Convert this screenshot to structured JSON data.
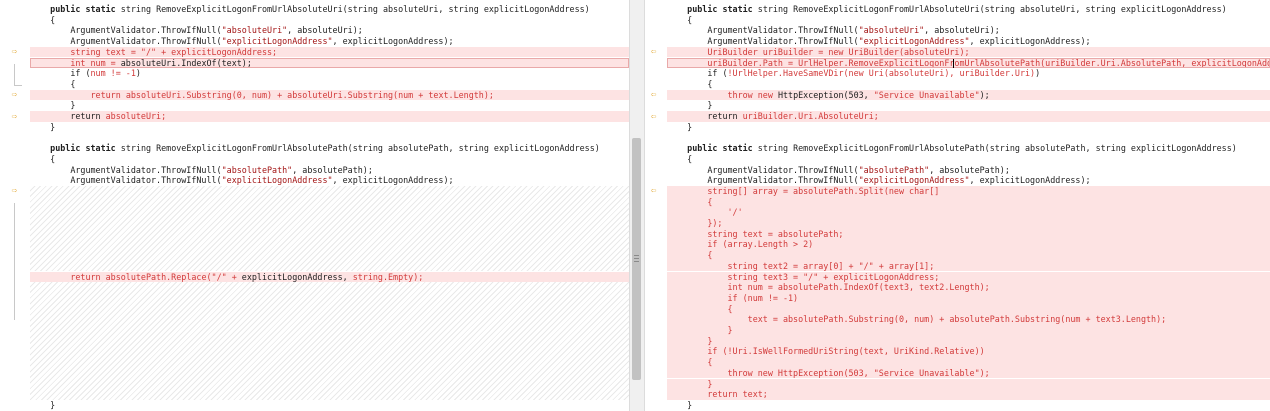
{
  "left_pane": {
    "lines": [
      {
        "segments": [
          {
            "text": "    "
          },
          {
            "text": "public static",
            "bold": true
          },
          {
            "text": " string RemoveExplicitLogonFromUrlAbsoluteUri(string absoluteUri, string explicitLogonAddress)"
          }
        ]
      },
      {
        "segments": [
          {
            "text": "    {"
          }
        ]
      },
      {
        "segments": [
          {
            "text": "        ArgumentValidator.ThrowIfNull("
          },
          {
            "text": "\"absoluteUri\"",
            "color": "#a31515"
          },
          {
            "text": ", absoluteUri);"
          }
        ]
      },
      {
        "segments": [
          {
            "text": "        ArgumentValidator.ThrowIfNull("
          },
          {
            "text": "\"explicitLogonAddress\"",
            "color": "#a31515"
          },
          {
            "text": ", explicitLogonAddress);"
          }
        ]
      },
      {
        "changed": true,
        "segments": [
          {
            "text": "        string text = \"/\" + explicitLogonAddress;",
            "color": "#d23a3a"
          }
        ]
      },
      {
        "changed": true,
        "selected": true,
        "segments": [
          {
            "text": "        int num = ",
            "color": "#d23a3a"
          },
          {
            "text": "absoluteUri.IndexOf(text);"
          }
        ]
      },
      {
        "segments": [
          {
            "text": "        if ("
          },
          {
            "text": "num != -1",
            "color": "#d23a3a"
          },
          {
            "text": ")"
          }
        ]
      },
      {
        "segments": [
          {
            "text": "        {"
          }
        ]
      },
      {
        "changed": true,
        "segments": [
          {
            "text": "            "
          },
          {
            "text": "return",
            "color": "#d23a3a"
          },
          {
            "text": " absoluteUri.Substring(0, num) + absoluteUri.Substring(num + text.Length);",
            "color": "#d23a3a"
          }
        ]
      },
      {
        "segments": [
          {
            "text": "        }"
          }
        ]
      },
      {
        "changed": true,
        "segments": [
          {
            "text": "        return "
          },
          {
            "text": "absoluteUri;",
            "color": "#d23a3a"
          }
        ]
      },
      {
        "segments": [
          {
            "text": "    }"
          }
        ]
      },
      {
        "segments": [
          {
            "text": ""
          }
        ]
      },
      {
        "segments": [
          {
            "text": "    "
          },
          {
            "text": "public static",
            "bold": true
          },
          {
            "text": " string RemoveExplicitLogonFromUrlAbsolutePath(string absolutePath, string explicitLogonAddress)"
          }
        ]
      },
      {
        "segments": [
          {
            "text": "    {"
          }
        ]
      },
      {
        "segments": [
          {
            "text": "        ArgumentValidator.ThrowIfNull("
          },
          {
            "text": "\"absolutePath\"",
            "color": "#a31515"
          },
          {
            "text": ", absolutePath);"
          }
        ]
      },
      {
        "segments": [
          {
            "text": "        ArgumentValidator.ThrowIfNull("
          },
          {
            "text": "\"explicitLogonAddress\"",
            "color": "#a31515"
          },
          {
            "text": ", explicitLogonAddress);"
          }
        ]
      },
      {
        "hatch_rows": 8
      },
      {
        "changed": true,
        "segments": [
          {
            "text": "        "
          },
          {
            "text": "return absolutePath.Replace(\"/\" + ",
            "color": "#d23a3a"
          },
          {
            "text": "explicitLogonAddress, "
          },
          {
            "text": "string.Empty);",
            "color": "#d23a3a"
          }
        ]
      },
      {
        "hatch_rows": 11
      },
      {
        "segments": [
          {
            "text": "    }"
          }
        ]
      }
    ]
  },
  "right_pane": {
    "lines": [
      {
        "segments": [
          {
            "text": "    "
          },
          {
            "text": "public static",
            "bold": true
          },
          {
            "text": " string RemoveExplicitLogonFromUrlAbsoluteUri(string absoluteUri, string explicitLogonAddress)"
          }
        ]
      },
      {
        "segments": [
          {
            "text": "    {"
          }
        ]
      },
      {
        "segments": [
          {
            "text": "        ArgumentValidator.ThrowIfNull("
          },
          {
            "text": "\"absoluteUri\"",
            "color": "#a31515"
          },
          {
            "text": ", absoluteUri);"
          }
        ]
      },
      {
        "segments": [
          {
            "text": "        ArgumentValidator.ThrowIfNull("
          },
          {
            "text": "\"explicitLogonAddress\"",
            "color": "#a31515"
          },
          {
            "text": ", explicitLogonAddress);"
          }
        ]
      },
      {
        "changed": true,
        "segments": [
          {
            "text": "        UriBuilder uriBuilder = new UriBuilder(absoluteUri);",
            "color": "#d23a3a"
          }
        ]
      },
      {
        "changed": true,
        "selected": true,
        "segments": [
          {
            "text": "        uriBuilder.Path = UrlHelper.RemoveExplicitLogonFromUrlAbsolutePath(uriBuilder.Uri.AbsolutePath, explicitLogonAddress);",
            "color": "#d23a3a"
          }
        ]
      },
      {
        "segments": [
          {
            "text": "        if ("
          },
          {
            "text": "!UrlHelper.HaveSameVDir(new Uri(absoluteUri), uriBuilder.Uri)",
            "color": "#d23a3a"
          },
          {
            "text": ")"
          }
        ]
      },
      {
        "segments": [
          {
            "text": "        {"
          }
        ]
      },
      {
        "changed": true,
        "segments": [
          {
            "text": "            "
          },
          {
            "text": "throw new",
            "color": "#d23a3a"
          },
          {
            "text": " HttpException(503, "
          },
          {
            "text": "\"Service Unavailable\"",
            "color": "#d23a3a"
          },
          {
            "text": ");"
          }
        ]
      },
      {
        "segments": [
          {
            "text": "        }"
          }
        ]
      },
      {
        "changed": true,
        "segments": [
          {
            "text": "        return "
          },
          {
            "text": "uriBuilder.Uri.AbsoluteUri;",
            "color": "#d23a3a"
          }
        ]
      },
      {
        "segments": [
          {
            "text": "    }"
          }
        ]
      },
      {
        "segments": [
          {
            "text": ""
          }
        ]
      },
      {
        "segments": [
          {
            "text": "    "
          },
          {
            "text": "public static",
            "bold": true
          },
          {
            "text": " string RemoveExplicitLogonFromUrlAbsolutePath(string absolutePath, string explicitLogonAddress)"
          }
        ]
      },
      {
        "segments": [
          {
            "text": "    {"
          }
        ]
      },
      {
        "segments": [
          {
            "text": "        ArgumentValidator.ThrowIfNull("
          },
          {
            "text": "\"absolutePath\"",
            "color": "#a31515"
          },
          {
            "text": ", absolutePath);"
          }
        ]
      },
      {
        "segments": [
          {
            "text": "        ArgumentValidator.ThrowIfNull("
          },
          {
            "text": "\"explicitLogonAddress\"",
            "color": "#a31515"
          },
          {
            "text": ", explicitLogonAddress);"
          }
        ]
      },
      {
        "changed": true,
        "segments": [
          {
            "text": "        string[] array = absolutePath.Split(new char[]",
            "color": "#d23a3a"
          }
        ]
      },
      {
        "changed": true,
        "segments": [
          {
            "text": "        {",
            "color": "#d23a3a"
          }
        ]
      },
      {
        "changed": true,
        "segments": [
          {
            "text": "            '/'",
            "color": "#d23a3a"
          }
        ]
      },
      {
        "changed": true,
        "segments": [
          {
            "text": "        });",
            "color": "#d23a3a"
          }
        ]
      },
      {
        "changed": true,
        "segments": [
          {
            "text": "        string text = absolutePath;",
            "color": "#d23a3a"
          }
        ]
      },
      {
        "changed": true,
        "segments": [
          {
            "text": "        if (array.Length > 2)",
            "color": "#d23a3a"
          }
        ]
      },
      {
        "changed": true,
        "segments": [
          {
            "text": "        {",
            "color": "#d23a3a"
          }
        ]
      },
      {
        "changed": true,
        "segments": [
          {
            "text": "            string text2 = array[0] + \"/\" + array[1];",
            "color": "#d23a3a"
          }
        ]
      },
      {
        "changed": true,
        "segments": [
          {
            "text": "            string text3 = \"/\" + explicitLogonAddress;",
            "color": "#d23a3a"
          }
        ]
      },
      {
        "changed": true,
        "segments": [
          {
            "text": "            int num = absolutePath.IndexOf(text3, text2.Length);",
            "color": "#d23a3a"
          }
        ]
      },
      {
        "changed": true,
        "segments": [
          {
            "text": "            if (num != -1)",
            "color": "#d23a3a"
          }
        ]
      },
      {
        "changed": true,
        "segments": [
          {
            "text": "            {",
            "color": "#d23a3a"
          }
        ]
      },
      {
        "changed": true,
        "segments": [
          {
            "text": "                text = absolutePath.Substring(0, num) + absolutePath.Substring(num + text3.Length);",
            "color": "#d23a3a"
          }
        ]
      },
      {
        "changed": true,
        "segments": [
          {
            "text": "            }",
            "color": "#d23a3a"
          }
        ]
      },
      {
        "changed": true,
        "segments": [
          {
            "text": "        }",
            "color": "#d23a3a"
          }
        ]
      },
      {
        "changed": true,
        "segments": [
          {
            "text": "        if (!Uri.IsWellFormedUriString(text, UriKind.Relative))",
            "color": "#d23a3a"
          }
        ]
      },
      {
        "changed": true,
        "segments": [
          {
            "text": "        {",
            "color": "#d23a3a"
          }
        ]
      },
      {
        "changed": true,
        "segments": [
          {
            "text": "            throw new HttpException(503, \"Service Unavailable\");",
            "color": "#d23a3a"
          }
        ]
      },
      {
        "changed": true,
        "segments": [
          {
            "text": "        }",
            "color": "#d23a3a"
          }
        ]
      },
      {
        "changed": true,
        "segments": [
          {
            "text": "        return text;",
            "color": "#d23a3a"
          }
        ]
      },
      {
        "segments": [
          {
            "text": "    }"
          }
        ]
      }
    ]
  },
  "left_markers": [
    4,
    8,
    10,
    17
  ],
  "right_markers": [
    4,
    8,
    10,
    17
  ],
  "marker_icons": {
    "left": "arrow-right-icon",
    "right": "arrow-left-icon"
  },
  "colors": {
    "changed_bg": "#fde3e3",
    "removed_text": "#d23a3a",
    "string_literal": "#a31515",
    "marker": "#e0a020"
  }
}
